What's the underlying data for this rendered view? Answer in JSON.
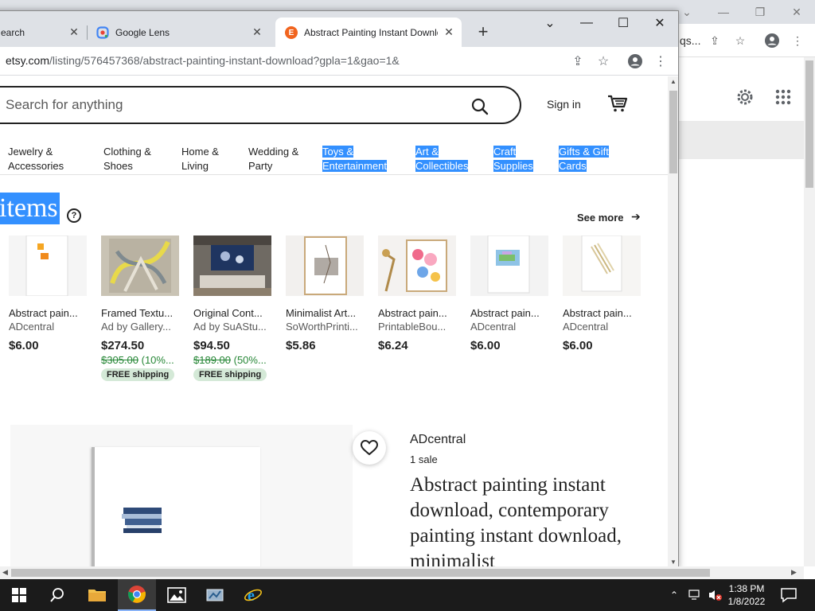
{
  "browser": {
    "tabs": [
      {
        "label": "earch"
      },
      {
        "label": "Google Lens"
      },
      {
        "label": "Abstract Painting Instant Download"
      }
    ],
    "url": {
      "host": "etsy.com",
      "path": "/listing/576457368/abstract-painting-instant-download?gpla=1&gao=1&"
    }
  },
  "background_window": {
    "url_fragment": "qs..."
  },
  "header": {
    "search_placeholder": "Search for anything",
    "sign_in": "Sign in"
  },
  "categories": [
    {
      "line1": "Jewelry &",
      "line2": "Accessories",
      "selected": false
    },
    {
      "line1": "Clothing &",
      "line2": "Shoes",
      "selected": false
    },
    {
      "line1": "Home &",
      "line2": "Living",
      "selected": false
    },
    {
      "line1": "Wedding &",
      "line2": "Party",
      "selected": false
    },
    {
      "line1": "Toys &",
      "line2": "Entertainment",
      "selected": true
    },
    {
      "line1": "Art &",
      "line2": "Collectibles",
      "selected": true
    },
    {
      "line1": "Craft",
      "line2": "Supplies",
      "selected": true
    },
    {
      "line1": "Gifts & Gift",
      "line2": "Cards",
      "selected": true
    }
  ],
  "section": {
    "title": "items",
    "see_more": "See more"
  },
  "products": [
    {
      "title": "Abstract pain...",
      "shop": "ADcentral",
      "price": "$6.00",
      "orig_price": "",
      "discount": "",
      "free_shipping": ""
    },
    {
      "title": "Framed Textu...",
      "shop": "Ad by Gallery...",
      "price": "$274.50",
      "orig_price": "$305.00",
      "discount": " (10%...",
      "free_shipping": "FREE shipping"
    },
    {
      "title": "Original Cont...",
      "shop": "Ad by SuAStu...",
      "price": "$94.50",
      "orig_price": "$189.00",
      "discount": " (50%...",
      "free_shipping": "FREE shipping"
    },
    {
      "title": "Minimalist Art...",
      "shop": "SoWorthPrinti...",
      "price": "$5.86",
      "orig_price": "",
      "discount": "",
      "free_shipping": ""
    },
    {
      "title": "Abstract pain...",
      "shop": "PrintableBou...",
      "price": "$6.24",
      "orig_price": "",
      "discount": "",
      "free_shipping": ""
    },
    {
      "title": "Abstract pain...",
      "shop": "ADcentral",
      "price": "$6.00",
      "orig_price": "",
      "discount": "",
      "free_shipping": ""
    },
    {
      "title": "Abstract pain...",
      "shop": "ADcentral",
      "price": "$6.00",
      "orig_price": "",
      "discount": "",
      "free_shipping": ""
    }
  ],
  "listing": {
    "shop_name": "ADcentral",
    "sales": "1 sale",
    "title": "Abstract painting instant download, contemporary painting instant download, minimalist"
  },
  "taskbar": {
    "time": "1:38 PM",
    "date": "1/8/2022"
  },
  "colors": {
    "selection": "#3390ff",
    "etsy_orange": "#f1641e",
    "free_shipping_bg": "#d4e9d7",
    "discount_green": "#258635"
  }
}
